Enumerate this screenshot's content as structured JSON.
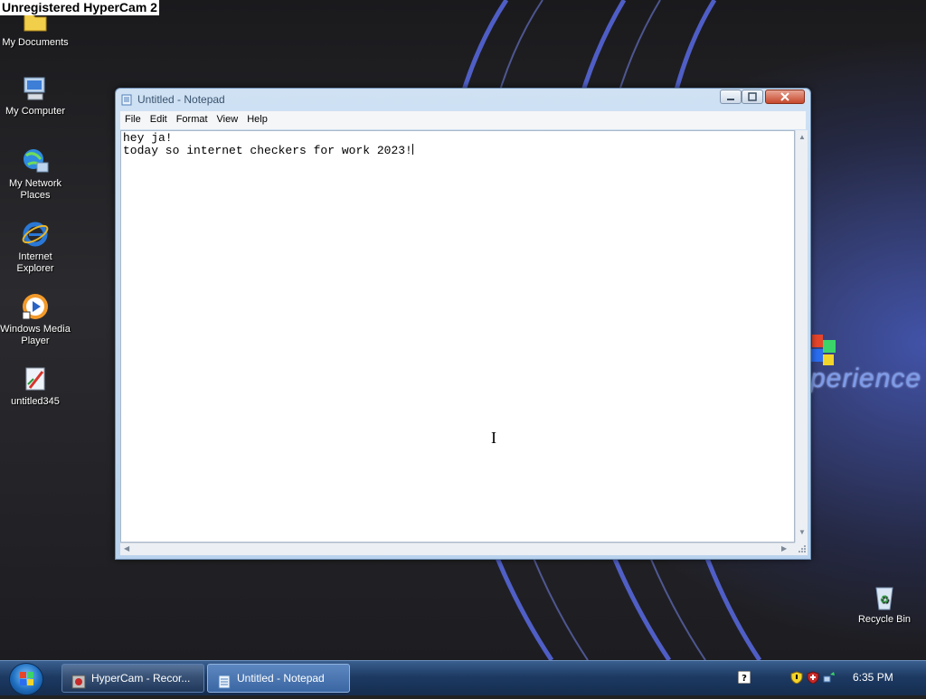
{
  "watermark": "Unregistered HyperCam 2",
  "desktop": {
    "icons": [
      {
        "label": "My Documents",
        "icon": "folder-icon"
      },
      {
        "label": "My Computer",
        "icon": "computer-icon"
      },
      {
        "label": "My Network Places",
        "icon": "network-icon"
      },
      {
        "label": "Internet Explorer",
        "icon": "ie-icon"
      },
      {
        "label": "Windows Media Player",
        "icon": "media-player-icon"
      },
      {
        "label": "untitled345",
        "icon": "paint-file-icon"
      },
      {
        "label": "Recycle Bin",
        "icon": "recycle-bin-icon"
      }
    ],
    "wallpaper_text": "perience"
  },
  "notepad": {
    "title": "Untitled - Notepad",
    "menu": [
      "File",
      "Edit",
      "Format",
      "View",
      "Help"
    ],
    "text": "hey ja!\ntoday so internet checkers for work 2023!"
  },
  "taskbar": {
    "buttons": [
      {
        "label": "HyperCam - Recor...",
        "icon": "hypercam-icon"
      },
      {
        "label": "Untitled - Notepad",
        "icon": "notepad-icon"
      }
    ],
    "clock": "6:35 PM"
  },
  "colors": {
    "taskbar": "#1d3a63",
    "titlebar": "#cfe1f3",
    "close_button": "#c6482c",
    "desktop_accent": "#4659b8"
  }
}
